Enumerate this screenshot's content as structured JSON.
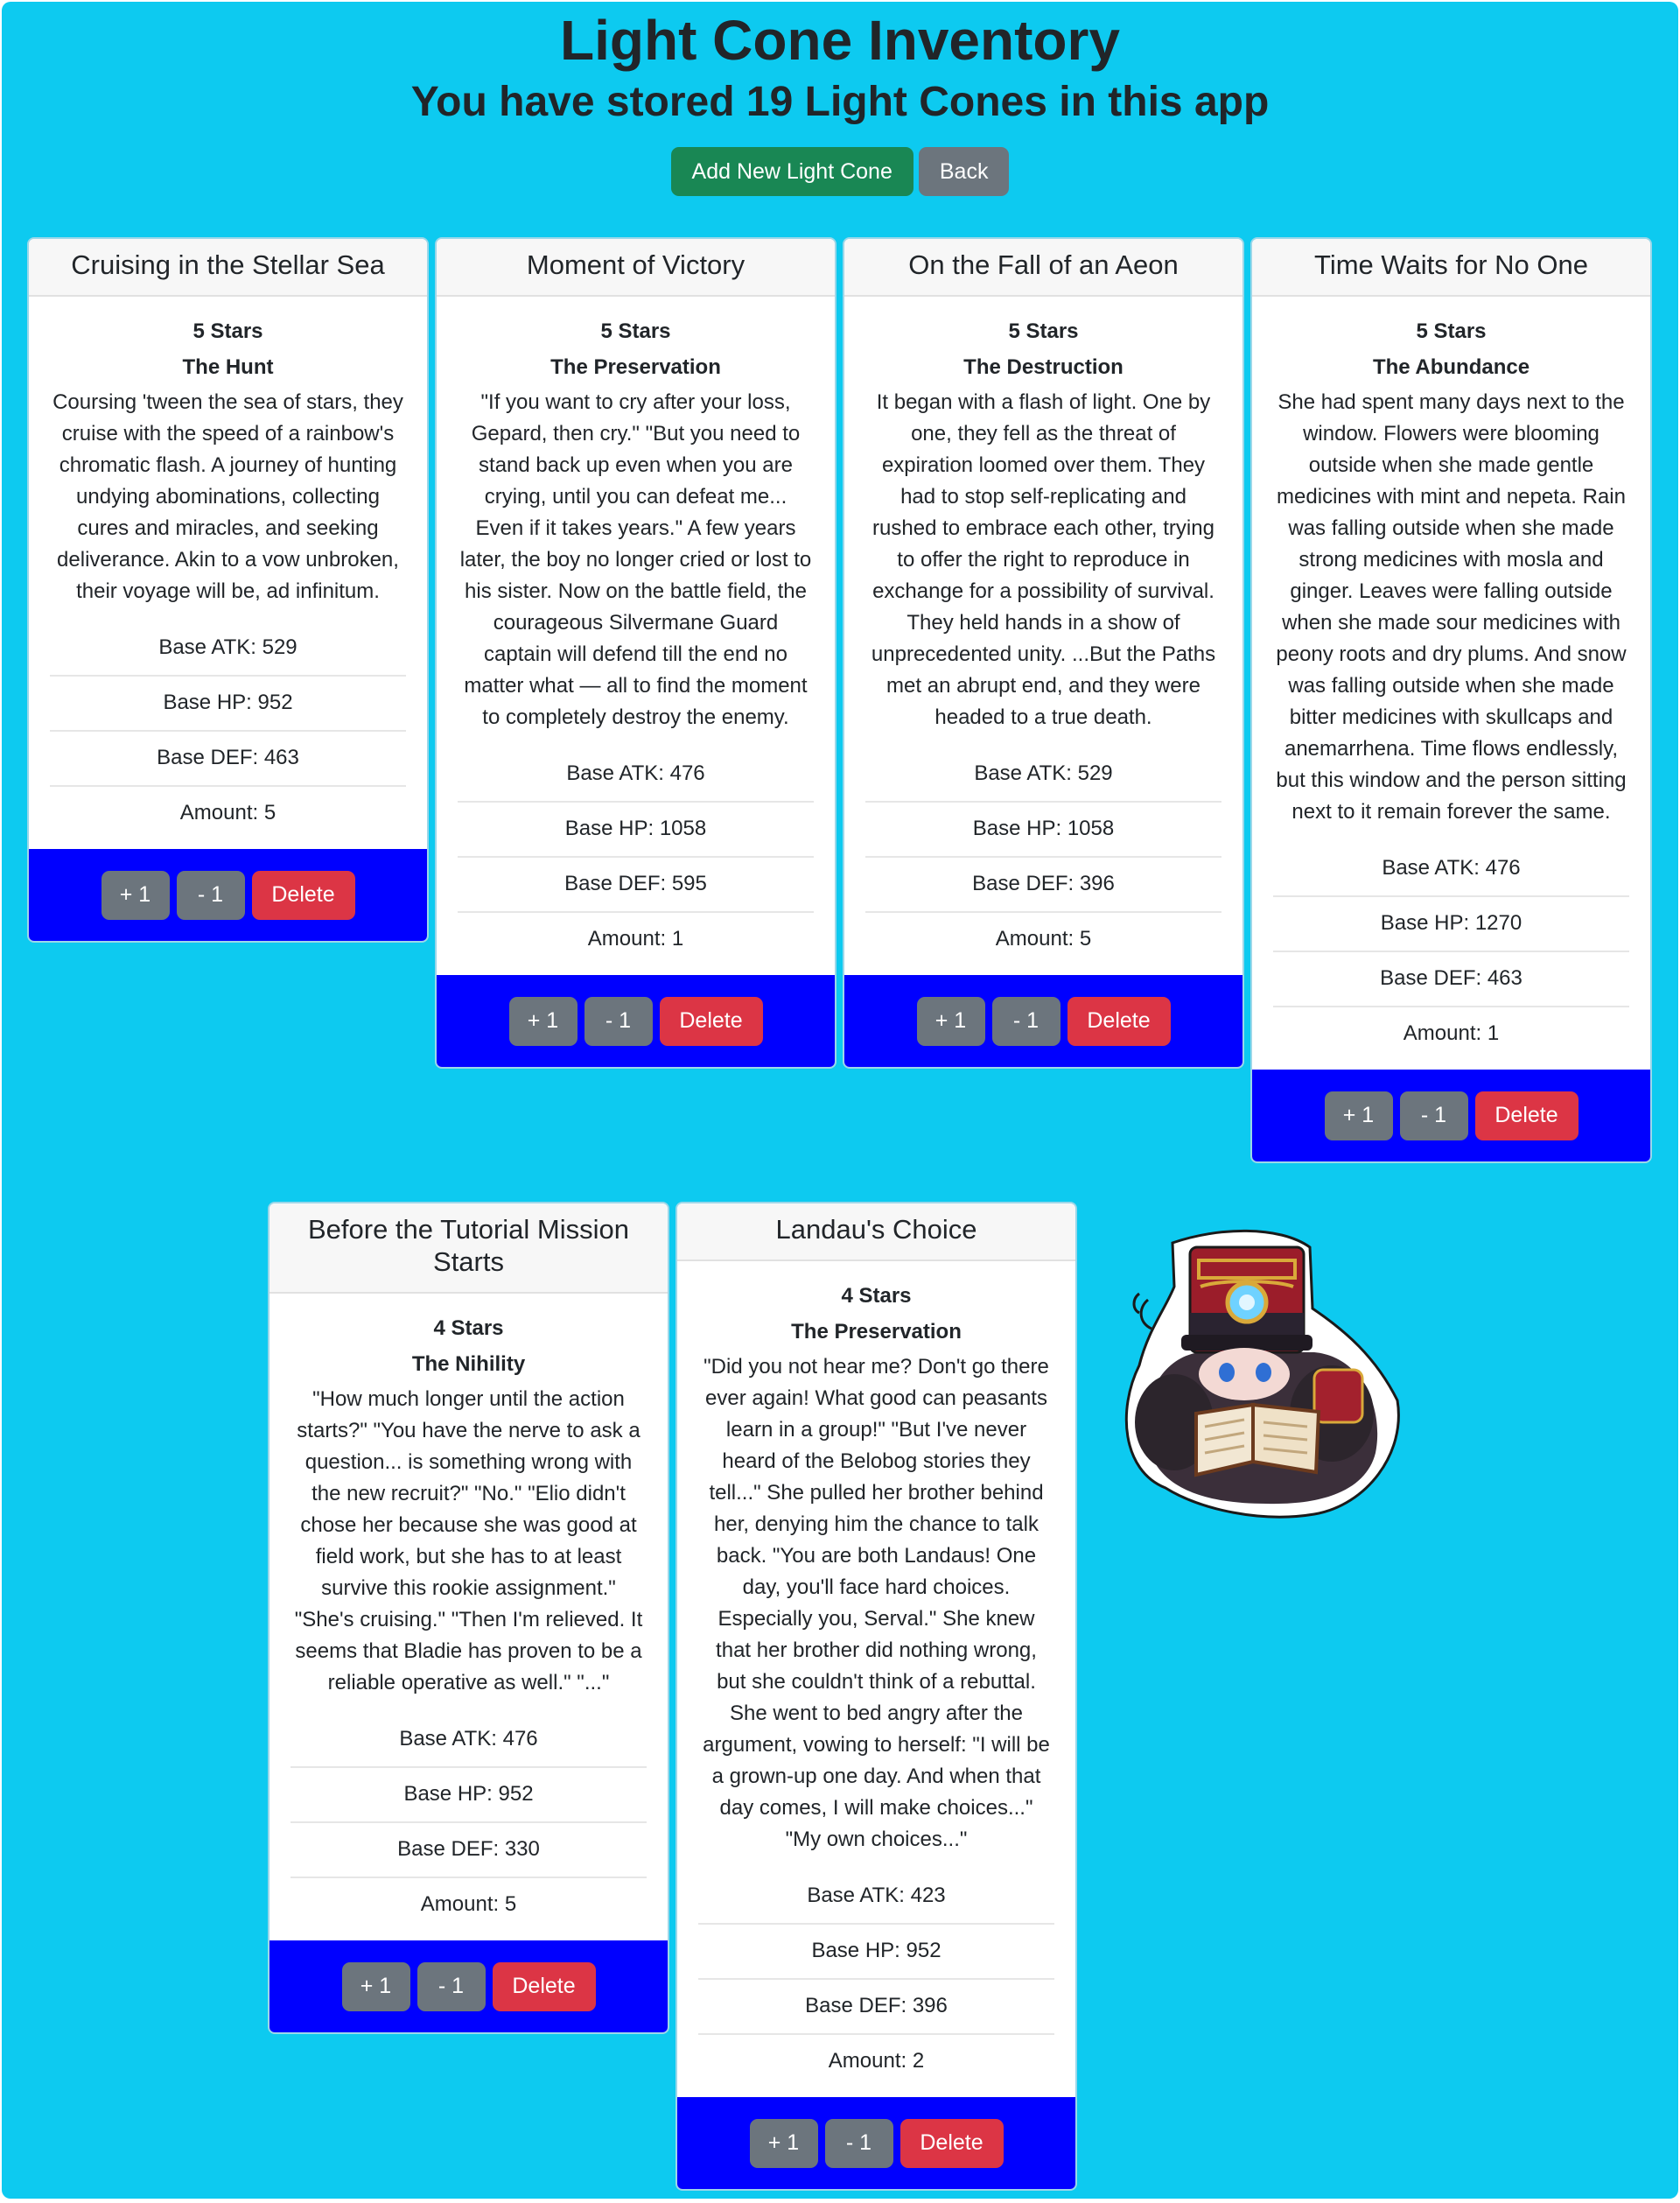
{
  "header": {
    "title": "Light Cone Inventory",
    "subtitle_prefix": "You have stored ",
    "count": "19",
    "subtitle_suffix": " Light Cones in this app"
  },
  "actions": {
    "add_label": "Add New Light Cone",
    "back_label": "Back"
  },
  "card_buttons": {
    "increment": "+ 1",
    "decrement": "- 1",
    "delete": "Delete"
  },
  "cards": [
    {
      "name": "Cruising in the Stellar Sea",
      "rarity": "5 Stars",
      "path": "The Hunt",
      "description": "Coursing 'tween the sea of stars, they cruise with the speed of a rainbow's chromatic flash. A journey of hunting undying abominations, collecting cures and miracles, and seeking deliverance. Akin to a vow unbroken, their voyage will be, ad infinitum.",
      "atk": "Base ATK: 529",
      "hp": "Base HP: 952",
      "def": "Base DEF: 463",
      "amount": "Amount: 5"
    },
    {
      "name": "Moment of Victory",
      "rarity": "5 Stars",
      "path": "The Preservation",
      "description": "\"If you want to cry after your loss, Gepard, then cry.\" \"But you need to stand back up even when you are crying, until you can defeat me... Even if it takes years.\" A few years later, the boy no longer cried or lost to his sister. Now on the battle field, the courageous Silvermane Guard captain will defend till the end no matter what — all to find the moment to completely destroy the enemy.",
      "atk": "Base ATK: 476",
      "hp": "Base HP: 1058",
      "def": "Base DEF: 595",
      "amount": "Amount: 1"
    },
    {
      "name": "On the Fall of an Aeon",
      "rarity": "5 Stars",
      "path": "The Destruction",
      "description": "It began with a flash of light. One by one, they fell as the threat of expiration loomed over them. They had to stop self-replicating and rushed to embrace each other, trying to offer the right to reproduce in exchange for a possibility of survival. They held hands in a show of unprecedented unity. ...But the Paths met an abrupt end, and they were headed to a true death.",
      "atk": "Base ATK: 529",
      "hp": "Base HP: 1058",
      "def": "Base DEF: 396",
      "amount": "Amount: 5"
    },
    {
      "name": "Time Waits for No One",
      "rarity": "5 Stars",
      "path": "The Abundance",
      "description": "She had spent many days next to the window. Flowers were blooming outside when she made gentle medicines with mint and nepeta. Rain was falling outside when she made strong medicines with mosla and ginger. Leaves were falling outside when she made sour medicines with peony roots and dry plums. And snow was falling outside when she made bitter medicines with skullcaps and anemarrhena. Time flows endlessly, but this window and the person sitting next to it remain forever the same.",
      "atk": "Base ATK: 476",
      "hp": "Base HP: 1270",
      "def": "Base DEF: 463",
      "amount": "Amount: 1"
    },
    {
      "name": "Before the Tutorial Mission Starts",
      "rarity": "4 Stars",
      "path": "The Nihility",
      "description": "\"How much longer until the action starts?\" \"You have the nerve to ask a question... is something wrong with the new recruit?\" \"No.\" \"Elio didn't chose her because she was good at field work, but she has to at least survive this rookie assignment.\" \"She's cruising.\" \"Then I'm relieved. It seems that Bladie has proven to be a reliable operative as well.\" \"...\"",
      "atk": "Base ATK: 476",
      "hp": "Base HP: 952",
      "def": "Base DEF: 330",
      "amount": "Amount: 5"
    },
    {
      "name": "Landau's Choice",
      "rarity": "4 Stars",
      "path": "The Preservation",
      "description": "\"Did you not hear me? Don't go there ever again! What good can peasants learn in a group!\" \"But I've never heard of the Belobog stories they tell...\" She pulled her brother behind her, denying him the chance to talk back. \"You are both Landaus! One day, you'll face hard choices. Especially you, Serval.\" She knew that her brother did nothing wrong, but she couldn't think of a rebuttal. She went to bed angry after the argument, vowing to herself: \"I will be a grown-up one day. And when that day comes, I will make choices...\" \"My own choices...\"",
      "atk": "Base ATK: 423",
      "hp": "Base HP: 952",
      "def": "Base DEF: 396",
      "amount": "Amount: 2"
    }
  ],
  "colors": {
    "panel_bg": "#0dcaf0",
    "card_footer_bg": "#0000ff",
    "success": "#198754",
    "secondary": "#6c757d",
    "danger": "#dc3545"
  }
}
